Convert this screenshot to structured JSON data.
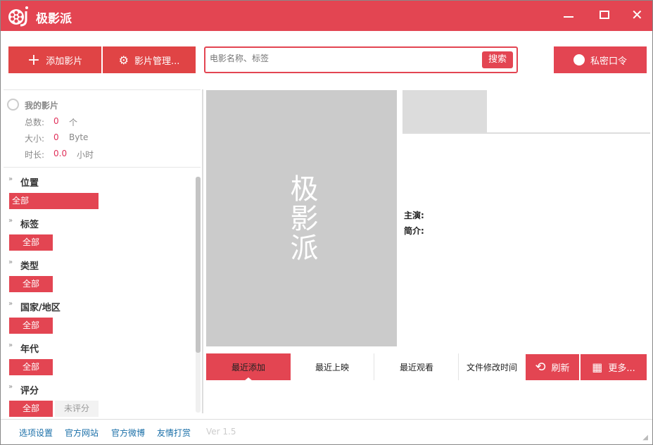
{
  "app": {
    "title": "极影派",
    "accent": "#e34552"
  },
  "window_controls": {
    "minimize": "minimize-icon",
    "maximize": "maximize-icon",
    "close": "close-icon"
  },
  "toolbar": {
    "add_label": "添加影片",
    "manage_label": "影片管理...",
    "search_placeholder": "电影名称、标签",
    "search_button": "搜索",
    "private_label": "私密口令"
  },
  "stats": {
    "title": "我的影片",
    "count_label": "总数:",
    "count_value": "0",
    "count_unit": "个",
    "size_label": "大小:",
    "size_value": "0",
    "size_unit": "Byte",
    "duration_label": "时长:",
    "duration_value": "0.0",
    "duration_unit": "小时"
  },
  "filters": [
    {
      "title": "位置",
      "options": [
        "全部"
      ]
    },
    {
      "title": "标签",
      "options": [
        "全部"
      ]
    },
    {
      "title": "类型",
      "options": [
        "全部"
      ]
    },
    {
      "title": "国家/地区",
      "options": [
        "全部"
      ]
    },
    {
      "title": "年代",
      "options": [
        "全部"
      ]
    },
    {
      "title": "评分",
      "options": [
        "全部",
        "未评分"
      ]
    }
  ],
  "poster": {
    "placeholder": "极影派"
  },
  "details": {
    "cast_label": "主演:",
    "intro_label": "简介:"
  },
  "sort_tabs": [
    "最近添加",
    "最近上映",
    "最近观看",
    "文件修改时间"
  ],
  "actions": {
    "refresh": "刷新",
    "more": "更多..."
  },
  "footer": {
    "links": [
      "选项设置",
      "官方网站",
      "官方微博",
      "友情打赏"
    ],
    "version": "Ver 1.5"
  }
}
